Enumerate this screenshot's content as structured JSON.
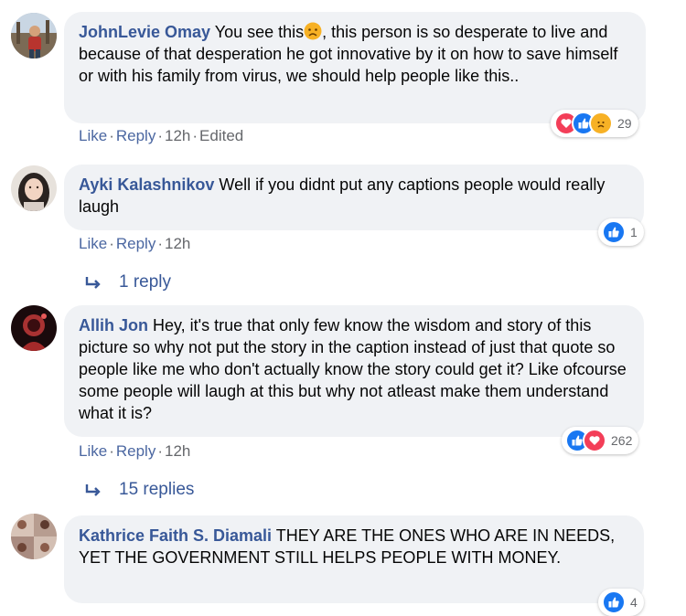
{
  "comments": [
    {
      "author": "JohnLevie Omay",
      "text_before": " You see this",
      "emoji": "sad-face",
      "text_after": ", this person is so desperate to live and because of that desperation he got innovative by it on how to save himself or with his family from virus, we should help people like this..",
      "actions": {
        "like": "Like",
        "reply": "Reply",
        "time": "12h",
        "edited": "Edited"
      },
      "reactions": {
        "icons": [
          "love",
          "like",
          "sad"
        ],
        "count": "29"
      }
    },
    {
      "author": "Ayki Kalashnikov",
      "text": " Well if you didnt put any captions people would really laugh",
      "actions": {
        "like": "Like",
        "reply": "Reply",
        "time": "12h"
      },
      "reactions": {
        "icons": [
          "like"
        ],
        "count": "1"
      },
      "replies": "1 reply"
    },
    {
      "author": "Allih Jon",
      "text": " Hey, it's true that only few know the wisdom and story of this picture so why not put the story in the caption instead of just that quote so people like me who don't actually know the story could get it? Like ofcourse some people will laugh at this but why not atleast make them understand what it is?",
      "actions": {
        "like": "Like",
        "reply": "Reply",
        "time": "12h"
      },
      "reactions": {
        "icons": [
          "like",
          "love"
        ],
        "count": "262"
      },
      "replies": "15 replies"
    },
    {
      "author": "Kathrice Faith S. Diamali",
      "text": " THEY ARE THE ONES WHO ARE IN NEEDS, YET THE GOVERNMENT STILL HELPS PEOPLE WITH MONEY.",
      "reactions": {
        "icons": [
          "like"
        ],
        "count": "4"
      }
    }
  ],
  "colors": {
    "author": "#385898",
    "bubble": "#f0f2f5",
    "like_blue": "#1877f2",
    "love_red": "#f33e58",
    "sad_yellow": "#f7b125"
  }
}
